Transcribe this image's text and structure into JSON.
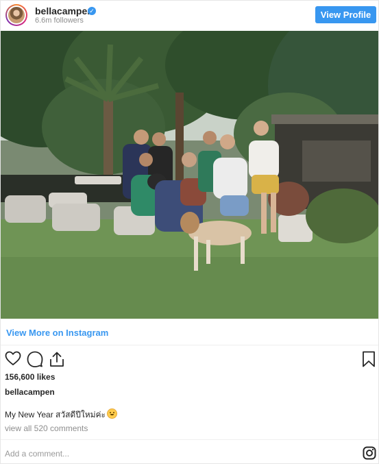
{
  "header": {
    "username": "bellacampen",
    "verified_mark": "✓",
    "followers": "6.6m followers",
    "view_profile_label": "View Profile",
    "verified_color": "#3897f0"
  },
  "post": {
    "view_more_label": "View More on Instagram",
    "likes": "156,600 likes",
    "caption_user": "bellacampen",
    "caption_text": "My New Year สวัสดีปีใหม่ค่ะ",
    "view_comments": "view all 520 comments",
    "add_comment_placeholder": "Add a comment...",
    "accent_color": "#3897f0"
  },
  "icons": {
    "actions": [
      "heart-icon",
      "comment-icon",
      "share-icon",
      "bookmark-icon"
    ],
    "footer": "instagram-icon"
  }
}
